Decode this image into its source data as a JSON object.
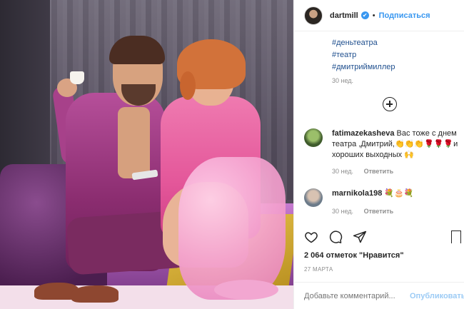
{
  "header": {
    "username": "dartmill",
    "verified_mark": "✔",
    "separator": "•",
    "follow_label": "Подписаться"
  },
  "caption": {
    "hashtags": [
      "#деньтеатра",
      "#театр",
      "#дмитриймиллер"
    ],
    "time": "30 нед."
  },
  "load_more_icon": "plus-circle-icon",
  "comments": [
    {
      "username": "fatimazekasheva",
      "text": "Вас тоже с днем театра ,Дмитрий,👏👏👏🌹🌹🌹и хороших выходных 🙌",
      "time": "30 нед.",
      "reply_label": "Ответить"
    },
    {
      "username": "marnikola198",
      "text": "💐🎂💐",
      "time": "30 нед.",
      "reply_label": "Ответить"
    }
  ],
  "actions": {
    "like_icon": "heart-icon",
    "comment_icon": "comment-icon",
    "share_icon": "paper-plane-icon",
    "save_icon": "bookmark-icon"
  },
  "likes_text": "2 064 отметок \"Нравится\"",
  "date_text": "27 МАРТА",
  "comment_box": {
    "placeholder": "Добавьте комментарий...",
    "post_label": "Опубликовать"
  },
  "colors": {
    "accent": "#3897f0",
    "hashtag": "#1f4f8e",
    "muted": "#8e8e8e"
  }
}
